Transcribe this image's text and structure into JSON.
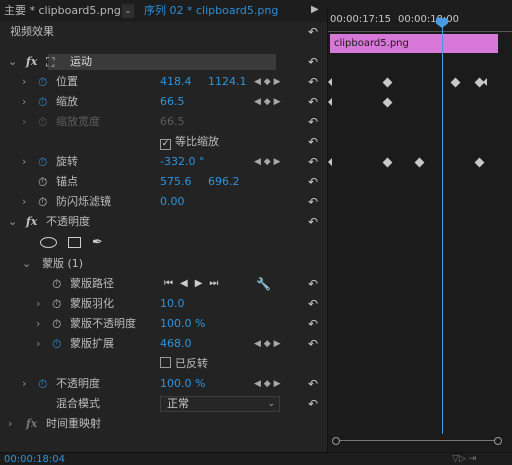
{
  "tabs": {
    "master": "主要 * clipboard5.png",
    "master_dropdown": "⌄",
    "sequence": "序列 02 * clipboard5.png",
    "play": "▶"
  },
  "ruler": {
    "time_start": "00:00:17:15",
    "time_playhead": "00:00:18:00"
  },
  "clip": {
    "name": "clipboard5.png"
  },
  "section_header": "视频效果",
  "rows": {
    "motion": {
      "label": "运动"
    },
    "position": {
      "label": "位置",
      "x": "418.4",
      "y": "1124.1"
    },
    "scale": {
      "label": "缩放",
      "value": "66.5"
    },
    "scale_width": {
      "label": "缩放宽度",
      "value": "66.5"
    },
    "uniform_scale": {
      "label": "等比缩放",
      "checked": true
    },
    "rotation": {
      "label": "旋转",
      "value": "-332.0 °"
    },
    "anchor": {
      "label": "锚点",
      "x": "575.6",
      "y": "696.2"
    },
    "anti_flicker": {
      "label": "防闪烁滤镜",
      "value": "0.00"
    },
    "opacity_group": {
      "label": "不透明度"
    },
    "mask": {
      "label": "蒙版 (1)"
    },
    "mask_path": {
      "label": "蒙版路径"
    },
    "mask_feather": {
      "label": "蒙版羽化",
      "value": "10.0"
    },
    "mask_opacity": {
      "label": "蒙版不透明度",
      "value": "100.0 %"
    },
    "mask_expansion": {
      "label": "蒙版扩展",
      "value": "468.0"
    },
    "inverted": {
      "label": "已反转",
      "checked": false
    },
    "opacity": {
      "label": "不透明度",
      "value": "100.0 %"
    },
    "blend_mode": {
      "label": "混合模式",
      "value": "正常"
    },
    "time_remap": {
      "label": "时间重映射"
    }
  },
  "footer": {
    "timecode": "00:00:18:04"
  },
  "colors": {
    "accent": "#2f93da",
    "clip": "#d777d7",
    "playhead": "#4a9ae0"
  }
}
